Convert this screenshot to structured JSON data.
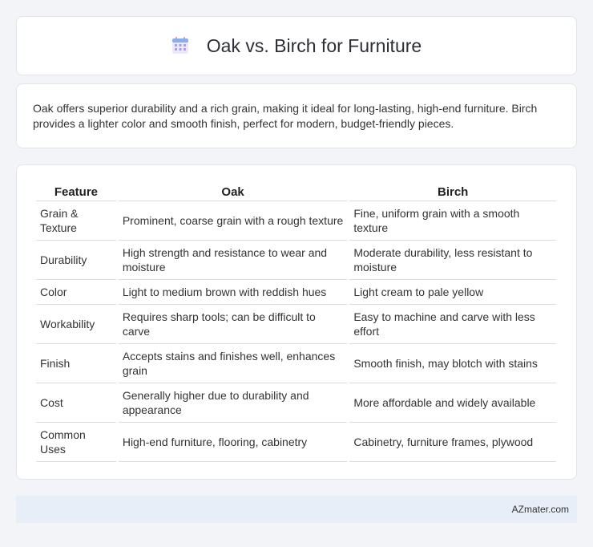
{
  "header": {
    "title": "Oak vs. Birch for Furniture",
    "icon": "calendar-icon",
    "accent": "#7b6ff0"
  },
  "summary": {
    "text": "Oak offers superior durability and a rich grain, making it ideal for long-lasting, high-end furniture. Birch provides a lighter color and smooth finish, perfect for modern, budget-friendly pieces."
  },
  "table": {
    "columns": [
      "Feature",
      "Oak",
      "Birch"
    ],
    "rows": [
      {
        "feature": "Grain & Texture",
        "oak": "Prominent, coarse grain with a rough texture",
        "birch": "Fine, uniform grain with a smooth texture"
      },
      {
        "feature": "Durability",
        "oak": "High strength and resistance to wear and moisture",
        "birch": "Moderate durability, less resistant to moisture"
      },
      {
        "feature": "Color",
        "oak": "Light to medium brown with reddish hues",
        "birch": "Light cream to pale yellow"
      },
      {
        "feature": "Workability",
        "oak": "Requires sharp tools; can be difficult to carve",
        "birch": "Easy to machine and carve with less effort"
      },
      {
        "feature": "Finish",
        "oak": "Accepts stains and finishes well, enhances grain",
        "birch": "Smooth finish, may blotch with stains"
      },
      {
        "feature": "Cost",
        "oak": "Generally higher due to durability and appearance",
        "birch": "More affordable and widely available"
      },
      {
        "feature": "Common Uses",
        "oak": "High-end furniture, flooring, cabinetry",
        "birch": "Cabinetry, furniture frames, plywood"
      }
    ]
  },
  "footer": {
    "brand": "AZmater.com"
  }
}
